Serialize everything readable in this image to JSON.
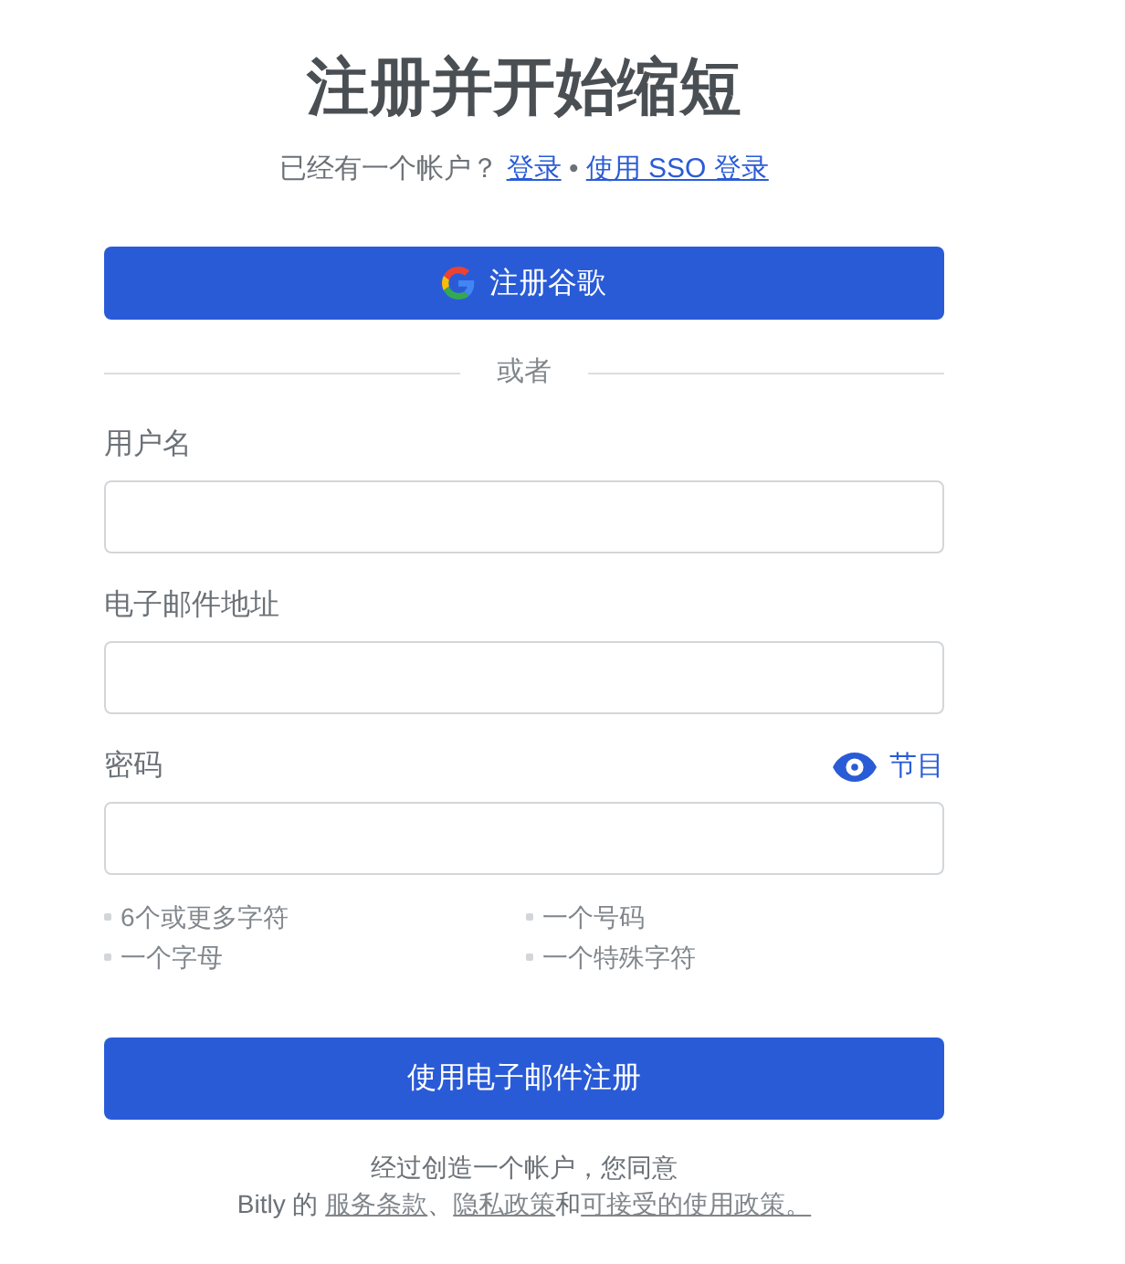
{
  "heading": {
    "title": "注册并开始缩短"
  },
  "login_prompt": {
    "parts": [
      {
        "kind": "text",
        "text": "已经有一个帐户？ "
      },
      {
        "kind": "link",
        "text": "登录"
      },
      {
        "kind": "text",
        "text": " • "
      },
      {
        "kind": "link",
        "text": "使用 SSO 登录"
      }
    ]
  },
  "google_button": {
    "label": "注册谷歌"
  },
  "divider": {
    "label": "或者"
  },
  "fields": [
    {
      "label": "用户名"
    },
    {
      "label": "电子邮件地址"
    },
    {
      "label": "密码",
      "toggle": {
        "label": "节目"
      }
    }
  ],
  "password_rules": [
    "6个或更多字符",
    "一个号码",
    "一个字母",
    "一个特殊字符"
  ],
  "submit_button": {
    "label": "使用电子邮件注册"
  },
  "terms": {
    "lines": [
      [
        {
          "kind": "text",
          "text": "经过创造一个帐户，您同意"
        }
      ],
      [
        {
          "kind": "text",
          "text": "Bitly 的 "
        },
        {
          "kind": "link",
          "text": "服务条款"
        },
        {
          "kind": "text",
          "text": "、"
        },
        {
          "kind": "link",
          "text": "隐私政策"
        },
        {
          "kind": "text",
          "text": "和"
        },
        {
          "kind": "link",
          "text": "可接受的使用政策。"
        }
      ]
    ]
  }
}
